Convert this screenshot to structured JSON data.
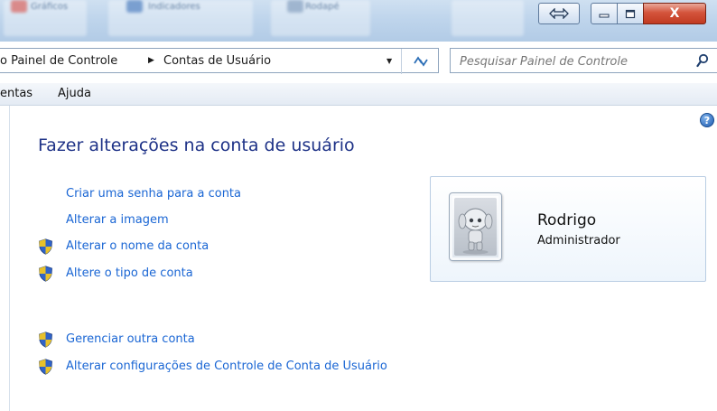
{
  "window": {
    "ghost_toolbar": [
      "Gráficos",
      "Indicadores",
      "Rodapé"
    ],
    "buttons": {
      "resize_icon": "double-arrow-icon",
      "minimize_icon": "minimize-icon",
      "maximize_icon": "maximize-icon",
      "close_label": "X"
    }
  },
  "address": {
    "crumbs": [
      "o Painel de Controle",
      "Contas de Usuário"
    ],
    "separator": "▶",
    "dropdown_glyph": "▼",
    "refresh_glyph": "↻"
  },
  "search": {
    "placeholder": "Pesquisar Painel de Controle",
    "value": ""
  },
  "menu": {
    "items": [
      "entas",
      "Ajuda"
    ]
  },
  "help": {
    "label": "?"
  },
  "main": {
    "heading": "Fazer alterações na conta de usuário",
    "links": [
      {
        "label": "Criar uma senha para a conta",
        "shield": false
      },
      {
        "label": "Alterar a imagem",
        "shield": false
      },
      {
        "label": "Alterar o nome da conta",
        "shield": true
      },
      {
        "label": "Altere o tipo de conta",
        "shield": true
      },
      {
        "label": "Gerenciar outra conta",
        "shield": true
      },
      {
        "label": "Alterar configurações de Controle de Conta de Usuário",
        "shield": true
      }
    ]
  },
  "user_card": {
    "name": "Rodrigo",
    "role": "Administrador"
  },
  "colors": {
    "link": "#1a66d4",
    "heading": "#1e3287",
    "titlebar": "#bfd5ec",
    "close_button": "#c13a21"
  }
}
